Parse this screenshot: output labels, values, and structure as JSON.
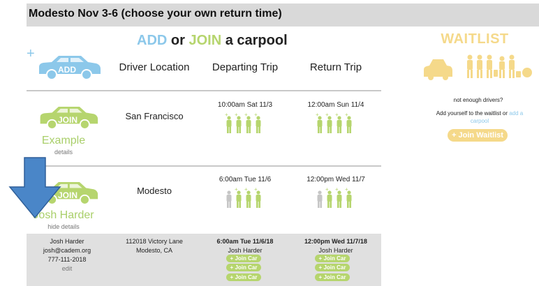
{
  "header": {
    "title": "Modesto Nov 3-6 (choose your own return time)"
  },
  "carpool_title": {
    "add": "ADD",
    "or": "or",
    "join": "JOIN",
    "a_carpool": "a carpool"
  },
  "add_button": {
    "label": "ADD",
    "plus": "+"
  },
  "columns": {
    "driver_location": "Driver Location",
    "departing_trip": "Departing Trip",
    "return_trip": "Return Trip"
  },
  "rows": [
    {
      "join_label": "JOIN",
      "name": "Example",
      "link": "details",
      "location": "San Francisco",
      "depart_time": "10:00am Sat 11/3",
      "return_time": "12:00am Sun 11/4",
      "depart_seats": {
        "taken": 0,
        "open": 4
      },
      "return_seats": {
        "taken": 0,
        "open": 4
      }
    },
    {
      "join_label": "JOIN",
      "name": "Josh Harder",
      "link": "hide details",
      "location": "Modesto",
      "depart_time": "6:00am Tue 11/6",
      "return_time": "12:00pm Wed 11/7",
      "depart_seats": {
        "taken": 1,
        "open": 3
      },
      "return_seats": {
        "taken": 1,
        "open": 3
      }
    }
  ],
  "details": {
    "driver_name": "Josh Harder",
    "email": "josh@cadem.org",
    "phone": "777-111-2018",
    "edit": "edit",
    "address_line1": "112018 Victory Lane",
    "address_line2": "Modesto, CA",
    "depart_time": "6:00am Tue 11/6/18",
    "depart_driver": "Josh Harder",
    "return_time": "12:00pm Wed 11/7/18",
    "return_driver": "Josh Harder",
    "join_car_label": "+ Join Car"
  },
  "waitlist": {
    "title": "WAITLIST",
    "not_enough": "not enough drivers?",
    "add_yourself": "Add yourself to the waitlist or",
    "add_carpool_link": "add a carpool",
    "join_button": "+ Join Waitlist"
  },
  "colors": {
    "add_blue": "#8cc8ea",
    "join_green": "#b6d56e",
    "waitlist_yellow": "#f5d98a",
    "arrow_blue": "#4a86c8",
    "seat_taken_gray": "#c6c6c6"
  }
}
